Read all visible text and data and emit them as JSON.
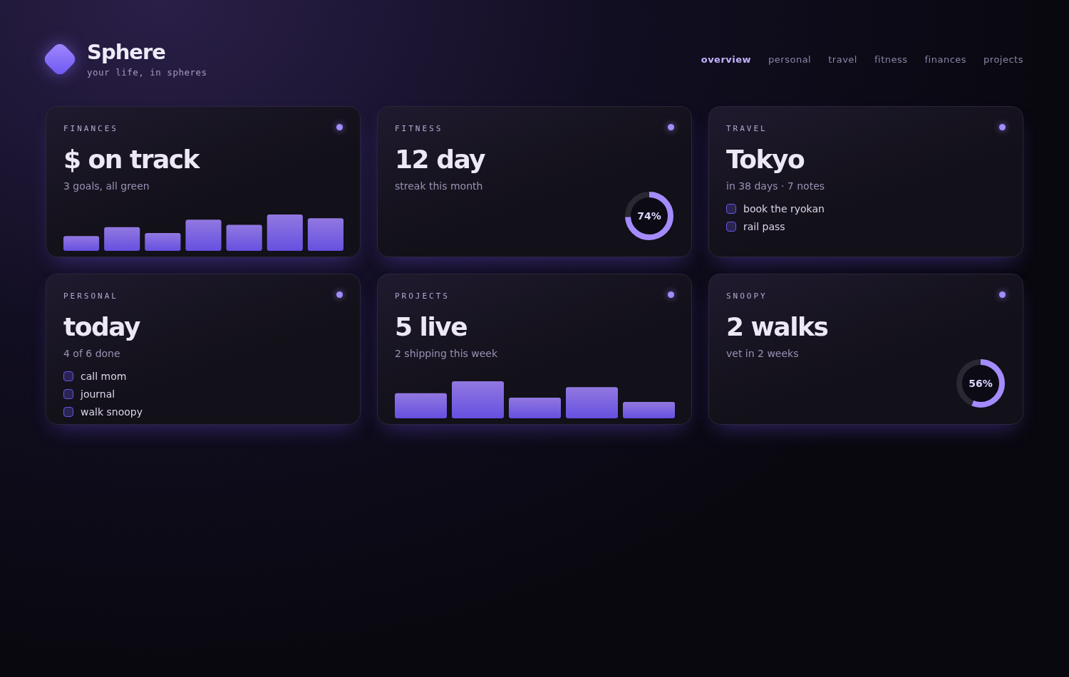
{
  "brand": {
    "name": "Sphere",
    "tagline": "your life, in spheres"
  },
  "nav": [
    {
      "label": "overview",
      "selected": true
    },
    {
      "label": "personal",
      "selected": false
    },
    {
      "label": "travel",
      "selected": false
    },
    {
      "label": "fitness",
      "selected": false
    },
    {
      "label": "finances",
      "selected": false
    },
    {
      "label": "projects",
      "selected": false
    }
  ],
  "cards": [
    {
      "kind": "bars",
      "label": "FINANCES",
      "headline": "$ on track",
      "subtitle": "3 goals, all green"
    },
    {
      "kind": "ring",
      "label": "FITNESS",
      "headline": "12 day",
      "subtitle": "streak this month",
      "level": 0.74,
      "reading": "74%"
    },
    {
      "kind": "checklist",
      "label": "TRAVEL",
      "headline": "Tokyo",
      "subtitle": "in 38 days · 7 notes",
      "items": [
        {
          "label": "book the ryokan",
          "checked": false
        },
        {
          "label": "rail pass",
          "checked": false
        }
      ]
    },
    {
      "kind": "checklist",
      "label": "PERSONAL",
      "headline": "today",
      "subtitle": "4 of 6 done",
      "items": [
        {
          "label": "call mom",
          "checked": false
        },
        {
          "label": "journal",
          "checked": false
        },
        {
          "label": "walk snoopy",
          "checked": false
        }
      ]
    },
    {
      "kind": "bars",
      "label": "PROJECTS",
      "headline": "5 live",
      "subtitle": "2 shipping this week"
    },
    {
      "kind": "ring",
      "label": "SNOOPY",
      "headline": "2 walks",
      "subtitle": "vet in 2 weeks",
      "level": 0.56,
      "reading": "56%"
    }
  ]
}
